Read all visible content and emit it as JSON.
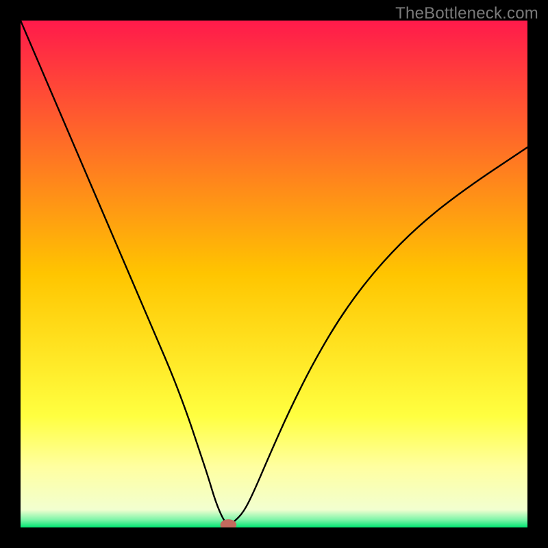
{
  "watermark": "TheBottleneck.com",
  "chart_data": {
    "type": "line",
    "title": "",
    "xlabel": "",
    "ylabel": "",
    "xlim": [
      0,
      100
    ],
    "ylim": [
      0,
      100
    ],
    "background_gradient": {
      "stops": [
        {
          "offset": 0.0,
          "color": "#ff1a4b"
        },
        {
          "offset": 0.5,
          "color": "#ffc500"
        },
        {
          "offset": 0.78,
          "color": "#ffff40"
        },
        {
          "offset": 0.88,
          "color": "#ffffa0"
        },
        {
          "offset": 0.965,
          "color": "#f2ffd0"
        },
        {
          "offset": 0.985,
          "color": "#7cf5a8"
        },
        {
          "offset": 1.0,
          "color": "#00e572"
        }
      ]
    },
    "series": [
      {
        "name": "bottleneck-curve",
        "color": "#000000",
        "width": 2.4,
        "x": [
          0,
          3,
          6,
          9,
          12,
          15,
          18,
          21,
          24,
          27,
          30,
          33,
          35,
          37,
          38.5,
          40,
          41,
          42,
          44,
          46,
          49,
          53,
          58,
          64,
          71,
          79,
          88,
          100
        ],
        "values": [
          100,
          93,
          86,
          79,
          72,
          65,
          58,
          51,
          44,
          37,
          30,
          22,
          16,
          10,
          5,
          1.5,
          0.5,
          1.0,
          3,
          7,
          14,
          23,
          33,
          43,
          52,
          60,
          67,
          75
        ]
      }
    ],
    "marker": {
      "name": "optimum-marker",
      "x": 41,
      "y": 0.5,
      "rx": 1.6,
      "ry": 1.1,
      "fill": "#c46a5e"
    }
  }
}
